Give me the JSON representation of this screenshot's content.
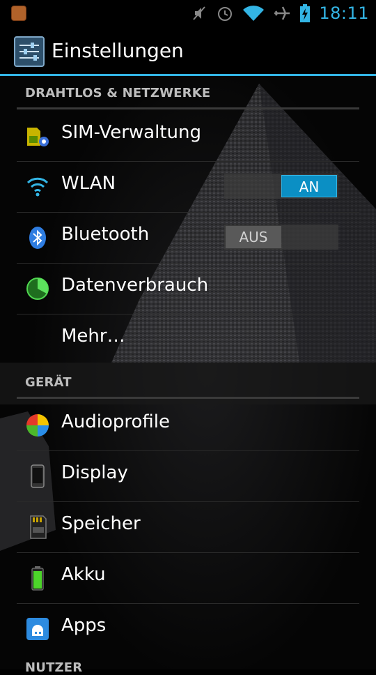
{
  "status_bar": {
    "time": "18:11",
    "icons": [
      "notification-icon",
      "mute-icon",
      "alarm-icon",
      "wifi-icon",
      "airplane-icon",
      "battery-charging-icon"
    ]
  },
  "action_bar": {
    "title": "Einstellungen",
    "icon": "settings-sliders-icon"
  },
  "sections": {
    "wireless": {
      "header": "DRAHTLOS & NETZWERKE",
      "items": [
        {
          "label": "SIM-Verwaltung",
          "icon": "sim-management-icon"
        },
        {
          "label": "WLAN",
          "icon": "wifi-icon",
          "toggle": "AN",
          "toggle_state": "on"
        },
        {
          "label": "Bluetooth",
          "icon": "bluetooth-icon",
          "toggle": "AUS",
          "toggle_state": "off"
        },
        {
          "label": "Datenverbrauch",
          "icon": "data-usage-icon"
        },
        {
          "label": "Mehr…"
        }
      ]
    },
    "device": {
      "header": "GERÄT",
      "items": [
        {
          "label": "Audioprofile",
          "icon": "audio-profiles-icon"
        },
        {
          "label": "Display",
          "icon": "display-icon"
        },
        {
          "label": "Speicher",
          "icon": "sd-card-icon"
        },
        {
          "label": "Akku",
          "icon": "battery-icon"
        },
        {
          "label": "Apps",
          "icon": "apps-icon"
        }
      ]
    },
    "users": {
      "header": "NUTZER"
    }
  },
  "colors": {
    "accent": "#33b5e5",
    "toggle_on": "#0b8fc4",
    "toggle_off": "#595959",
    "section_header": "#bdbdbd"
  }
}
